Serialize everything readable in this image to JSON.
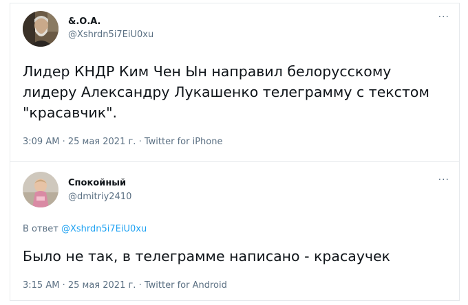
{
  "tweets": [
    {
      "name": "&.О.А.",
      "handle": "@Xshrdn5i7EiU0xu",
      "text": "Лидер КНДР Ким Чен Ын направил белорусскому лидеру Александру Лукашенко телеграмму с текстом \"красавчик\".",
      "time": "3:09 AM",
      "date": "25 мая 2021 г.",
      "source": "Twitter for iPhone",
      "more_label": "···"
    },
    {
      "name": "Спокойный",
      "handle": "@dmitriy2410",
      "reply_prefix": "В ответ",
      "reply_to": "@Xshrdn5i7EiU0xu",
      "text": "Было не так, в телеграмме написано - красаучек",
      "time": "3:15 AM",
      "date": "25 мая 2021 г.",
      "source": "Twitter for Android",
      "more_label": "···"
    }
  ],
  "separator": "·",
  "colors": {
    "text": "#0f1419",
    "muted": "#5b7083",
    "link": "#1da1f2",
    "border": "#e6e9ec"
  }
}
